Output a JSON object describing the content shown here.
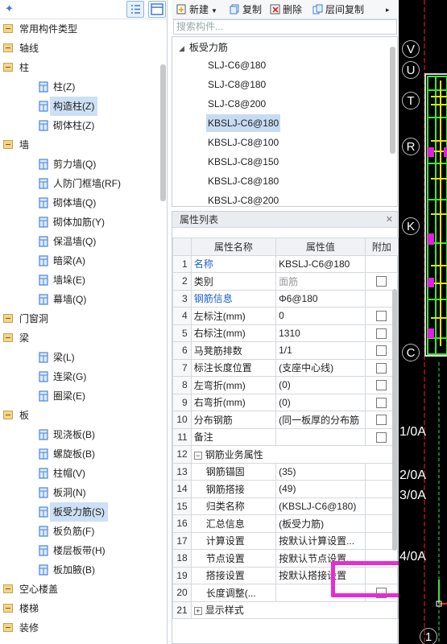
{
  "left_panel": {
    "tree": [
      {
        "type": "cat",
        "label": "常用构件类型",
        "icon": "folder-icon"
      },
      {
        "type": "cat",
        "label": "轴线",
        "icon": "folder-icon"
      },
      {
        "type": "cat",
        "label": "柱",
        "icon": "folder-icon"
      },
      {
        "type": "item",
        "label": "柱(Z)",
        "icon": "column-icon"
      },
      {
        "type": "item",
        "label": "构造柱(Z)",
        "icon": "constructional-column-icon",
        "selected": true
      },
      {
        "type": "item",
        "label": "砌体柱(Z)",
        "icon": "masonry-column-icon"
      },
      {
        "type": "cat",
        "label": "墙",
        "icon": "folder-icon"
      },
      {
        "type": "item",
        "label": "剪力墙(Q)",
        "icon": "shear-wall-icon"
      },
      {
        "type": "item",
        "label": "人防门框墙(RF)",
        "icon": "civil-defense-door-frame-wall-icon"
      },
      {
        "type": "item",
        "label": "砌体墙(Q)",
        "icon": "masonry-wall-icon"
      },
      {
        "type": "item",
        "label": "砌体加筋(Y)",
        "icon": "masonry-reinforcement-icon"
      },
      {
        "type": "item",
        "label": "保温墙(Q)",
        "icon": "insulation-wall-icon"
      },
      {
        "type": "item",
        "label": "暗梁(A)",
        "icon": "hidden-beam-icon"
      },
      {
        "type": "item",
        "label": "墙垛(E)",
        "icon": "wall-pier-icon"
      },
      {
        "type": "item",
        "label": "幕墙(Q)",
        "icon": "curtain-wall-icon"
      },
      {
        "type": "cat",
        "label": "门窗洞",
        "icon": "folder-icon"
      },
      {
        "type": "cat",
        "label": "梁",
        "icon": "folder-icon"
      },
      {
        "type": "item",
        "label": "梁(L)",
        "icon": "beam-icon"
      },
      {
        "type": "item",
        "label": "连梁(G)",
        "icon": "coupling-beam-icon"
      },
      {
        "type": "item",
        "label": "圈梁(E)",
        "icon": "ring-beam-icon"
      },
      {
        "type": "cat",
        "label": "板",
        "icon": "folder-icon"
      },
      {
        "type": "item",
        "label": "现浇板(B)",
        "icon": "cast-slab-icon"
      },
      {
        "type": "item",
        "label": "螺旋板(B)",
        "icon": "spiral-slab-icon"
      },
      {
        "type": "item",
        "label": "柱帽(V)",
        "icon": "column-cap-icon"
      },
      {
        "type": "item",
        "label": "板洞(N)",
        "icon": "slab-hole-icon"
      },
      {
        "type": "item",
        "label": "板受力筋(S)",
        "icon": "slab-rebar-icon",
        "selected": true
      },
      {
        "type": "item",
        "label": "板负筋(F)",
        "icon": "slab-negative-rebar-icon"
      },
      {
        "type": "item",
        "label": "楼层板带(H)",
        "icon": "floor-slab-strip-icon"
      },
      {
        "type": "item",
        "label": "板加腋(B)",
        "icon": "slab-haunch-icon"
      },
      {
        "type": "cat",
        "label": "空心楼盖",
        "icon": "folder-icon"
      },
      {
        "type": "cat",
        "label": "楼梯",
        "icon": "folder-icon"
      },
      {
        "type": "cat",
        "label": "装修",
        "icon": "folder-icon"
      }
    ]
  },
  "toolbar": {
    "new_label": "新建",
    "copy_label": "复制",
    "delete_label": "删除",
    "floor_copy_label": "层间复制"
  },
  "search": {
    "placeholder": "搜索构件..."
  },
  "component_list": {
    "group": "板受力筋",
    "items": [
      {
        "label": "SLJ-C6@180"
      },
      {
        "label": "SLJ-C8@180"
      },
      {
        "label": "SLJ-C8@200"
      },
      {
        "label": "KBSLJ-C6@180",
        "selected": true
      },
      {
        "label": "KBSLJ-C8@100"
      },
      {
        "label": "KBSLJ-C8@150"
      },
      {
        "label": "KBSLJ-C8@180"
      },
      {
        "label": "KBSLJ-C8@200"
      }
    ]
  },
  "properties": {
    "title": "属性列表",
    "headers": {
      "name": "属性名称",
      "value": "属性值",
      "extra": "附加"
    },
    "rows": [
      {
        "n": "1",
        "name": "名称",
        "value": "KBSLJ-C6@180",
        "blue": true,
        "check": false
      },
      {
        "n": "2",
        "name": "类别",
        "value": "面筋",
        "valueGray": true,
        "check": true
      },
      {
        "n": "3",
        "name": "钢筋信息",
        "value": "Φ6@180",
        "blue": true,
        "check": false
      },
      {
        "n": "4",
        "name": "左标注(mm)",
        "value": "0",
        "check": true
      },
      {
        "n": "5",
        "name": "右标注(mm)",
        "value": "1310",
        "check": true
      },
      {
        "n": "6",
        "name": "马凳筋排数",
        "value": "1/1",
        "check": true
      },
      {
        "n": "7",
        "name": "标注长度位置",
        "value": "(支座中心线)",
        "check": true
      },
      {
        "n": "8",
        "name": "左弯折(mm)",
        "value": "(0)",
        "check": true
      },
      {
        "n": "9",
        "name": "右弯折(mm)",
        "value": "(0)",
        "check": true
      },
      {
        "n": "10",
        "name": "分布钢筋",
        "value": "(同一板厚的分布筋",
        "check": true
      },
      {
        "n": "11",
        "name": "备注",
        "value": "",
        "check": true
      },
      {
        "n": "12",
        "name": "钢筋业务属性",
        "value": "",
        "group": true
      },
      {
        "n": "13",
        "name": "钢筋锚固",
        "value": "(35)",
        "indent": true
      },
      {
        "n": "14",
        "name": "钢筋搭接",
        "value": "(49)",
        "indent": true
      },
      {
        "n": "15",
        "name": "归类名称",
        "value": "(KBSLJ-C6@180)",
        "indent": true
      },
      {
        "n": "16",
        "name": "汇总信息",
        "value": "(板受力筋)",
        "indent": true
      },
      {
        "n": "17",
        "name": "计算设置",
        "value": "按默认计算设置...",
        "indent": true
      },
      {
        "n": "18",
        "name": "节点设置",
        "value": "按默认节点设置...",
        "indent": true
      },
      {
        "n": "19",
        "name": "搭接设置",
        "value": "按默认搭接设置",
        "indent": true
      },
      {
        "n": "20",
        "name": "长度调整(...",
        "value": "",
        "indent": true,
        "check": true
      },
      {
        "n": "21",
        "name": "显示样式",
        "value": "",
        "group": true
      }
    ]
  },
  "cad": {
    "axis_labels": [
      "V",
      "U",
      "T",
      "R",
      "K",
      "C",
      "1/0A",
      "2/0A",
      "3/0A",
      "4/0A",
      "1"
    ],
    "colors": {
      "green": "#39e639",
      "yellow": "#e6e600",
      "magenta": "#e020e0",
      "red": "#ff2020"
    }
  },
  "colors": {
    "highlight": "#e92bd6",
    "accent": "#1e5ec8",
    "selection": "#c7dcf3"
  }
}
